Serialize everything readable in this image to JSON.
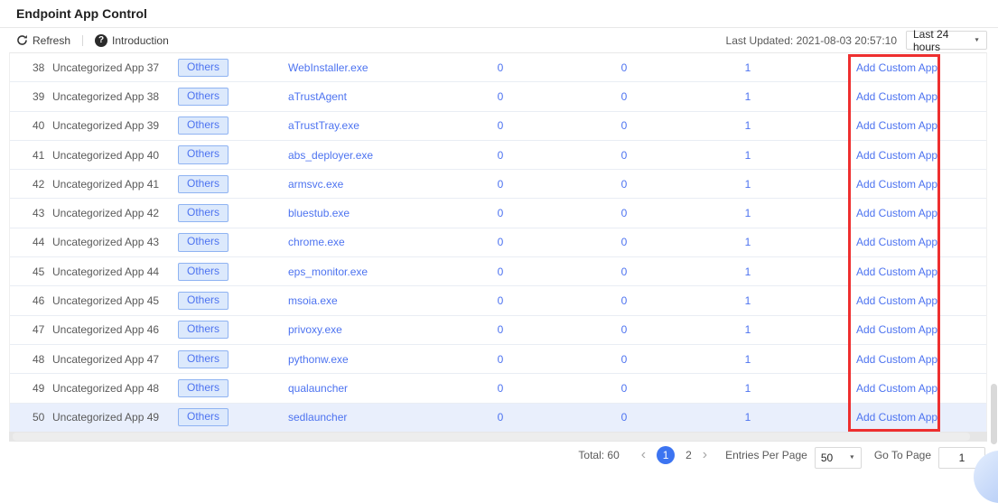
{
  "page": {
    "title": "Endpoint App Control"
  },
  "toolbar": {
    "refresh_label": "Refresh",
    "introduction_label": "Introduction",
    "last_updated": "Last Updated: 2021-08-03 20:57:10",
    "time_range_value": "Last 24 hours"
  },
  "icons": {
    "caret_down": "▼",
    "help": "?",
    "prev": "‹",
    "next": "›"
  },
  "table": {
    "rows": [
      {
        "index": "38",
        "name": "Uncategorized App 37",
        "category": "Others",
        "process": "WebInstaller.exe",
        "c1": "0",
        "c2": "0",
        "c3": "1",
        "action": "Add Custom App",
        "highlighted": false
      },
      {
        "index": "39",
        "name": "Uncategorized App 38",
        "category": "Others",
        "process": "aTrustAgent",
        "c1": "0",
        "c2": "0",
        "c3": "1",
        "action": "Add Custom App",
        "highlighted": false
      },
      {
        "index": "40",
        "name": "Uncategorized App 39",
        "category": "Others",
        "process": "aTrustTray.exe",
        "c1": "0",
        "c2": "0",
        "c3": "1",
        "action": "Add Custom App",
        "highlighted": false
      },
      {
        "index": "41",
        "name": "Uncategorized App 40",
        "category": "Others",
        "process": "abs_deployer.exe",
        "c1": "0",
        "c2": "0",
        "c3": "1",
        "action": "Add Custom App",
        "highlighted": false
      },
      {
        "index": "42",
        "name": "Uncategorized App 41",
        "category": "Others",
        "process": "armsvc.exe",
        "c1": "0",
        "c2": "0",
        "c3": "1",
        "action": "Add Custom App",
        "highlighted": false
      },
      {
        "index": "43",
        "name": "Uncategorized App 42",
        "category": "Others",
        "process": "bluestub.exe",
        "c1": "0",
        "c2": "0",
        "c3": "1",
        "action": "Add Custom App",
        "highlighted": false
      },
      {
        "index": "44",
        "name": "Uncategorized App 43",
        "category": "Others",
        "process": "chrome.exe",
        "c1": "0",
        "c2": "0",
        "c3": "1",
        "action": "Add Custom App",
        "highlighted": false
      },
      {
        "index": "45",
        "name": "Uncategorized App 44",
        "category": "Others",
        "process": "eps_monitor.exe",
        "c1": "0",
        "c2": "0",
        "c3": "1",
        "action": "Add Custom App",
        "highlighted": false
      },
      {
        "index": "46",
        "name": "Uncategorized App 45",
        "category": "Others",
        "process": "msoia.exe",
        "c1": "0",
        "c2": "0",
        "c3": "1",
        "action": "Add Custom App",
        "highlighted": false
      },
      {
        "index": "47",
        "name": "Uncategorized App 46",
        "category": "Others",
        "process": "privoxy.exe",
        "c1": "0",
        "c2": "0",
        "c3": "1",
        "action": "Add Custom App",
        "highlighted": false
      },
      {
        "index": "48",
        "name": "Uncategorized App 47",
        "category": "Others",
        "process": "pythonw.exe",
        "c1": "0",
        "c2": "0",
        "c3": "1",
        "action": "Add Custom App",
        "highlighted": false
      },
      {
        "index": "49",
        "name": "Uncategorized App 48",
        "category": "Others",
        "process": "qualauncher",
        "c1": "0",
        "c2": "0",
        "c3": "1",
        "action": "Add Custom App",
        "highlighted": false
      },
      {
        "index": "50",
        "name": "Uncategorized App 49",
        "category": "Others",
        "process": "sedlauncher",
        "c1": "0",
        "c2": "0",
        "c3": "1",
        "action": "Add Custom App",
        "highlighted": true
      }
    ]
  },
  "pagination": {
    "total_label": "Total: 60",
    "current_page": "1",
    "other_page": "2",
    "entries_per_page_label": "Entries Per Page",
    "entries_per_page_value": "50",
    "go_to_page_label": "Go To Page",
    "go_to_page_value": "1"
  },
  "colors": {
    "accent_blue": "#4d73f0",
    "highlight_red": "#ee2f2f",
    "active_page_blue": "#3c74f1",
    "badge_bg": "#dce9fc",
    "badge_border": "#8fb3f2",
    "row_highlight": "#e9effc"
  }
}
